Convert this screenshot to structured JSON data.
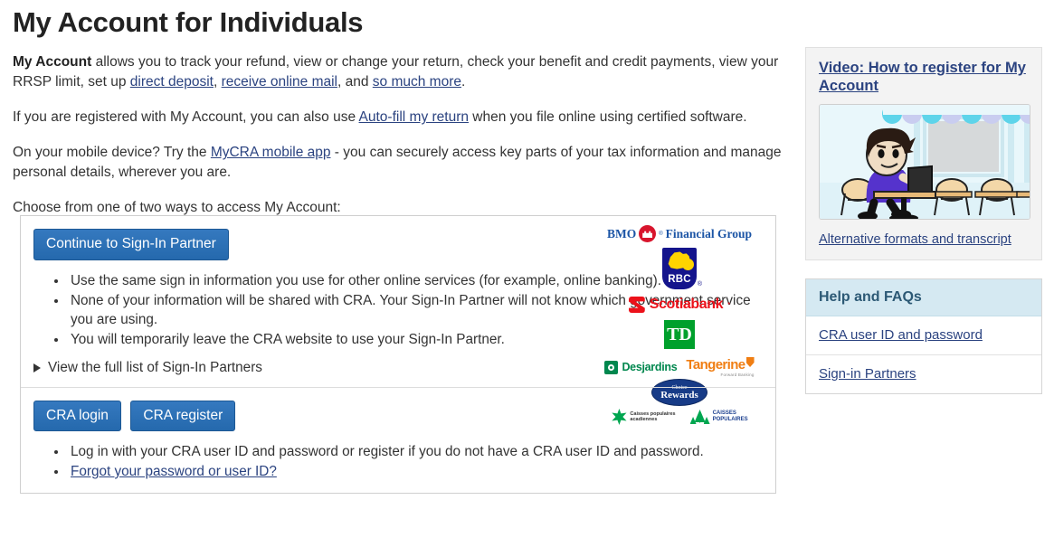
{
  "page": {
    "title": "My Account for Individuals"
  },
  "intro": {
    "p1_lead": "My Account",
    "p1_a": " allows you to track your refund, view or change your return, check your benefit and credit payments, view your RRSP limit, set up ",
    "p1_link1": "direct deposit",
    "p1_b": ", ",
    "p1_link2": "receive online mail",
    "p1_c": ", and ",
    "p1_link3": "so much more",
    "p1_d": ".",
    "p2_a": "If you are registered with My Account, you can also use ",
    "p2_link": "Auto-fill my return",
    "p2_b": " when you file online using certified software.",
    "p3_a": "On your mobile device? Try the ",
    "p3_link": "MyCRA mobile app",
    "p3_b": " - you can securely access key parts of your tax information and manage personal details, wherever you are.",
    "p4": "Choose from one of two ways to access My Account:"
  },
  "signin_partner": {
    "button_label": "Continue to Sign-In Partner",
    "bullets": [
      "Use the same sign in information you use for other online services (for example, online banking).",
      "None of your information will be shared with CRA. Your Sign-In Partner will not know which government service you are using.",
      "You will temporarily leave the CRA website to use your Sign-In Partner."
    ],
    "disclosure_label": "View the full list of Sign-In Partners"
  },
  "partner_logos": {
    "bmo_text_1": "BMO",
    "bmo_text_2": "Financial Group",
    "bmo_registered": "®",
    "rbc_text": "RBC",
    "rbc_registered": "®",
    "scotiabank_text": "Scotiabank",
    "scotiabank_registered": "*",
    "td_text": "TD",
    "desjardins_text": "Desjardins",
    "tangerine_text": "Tangerine",
    "tangerine_tagline": "Forward Banking",
    "choice_rewards_line1": "Choice",
    "choice_rewards_line2": "Rewards",
    "caisses_acadiennes_line1": "Caisses populaires",
    "caisses_acadiennes_line2": "acadiennes",
    "caisses_populaires_line1": "CAISSES",
    "caisses_populaires_line2": "POPULAIRES"
  },
  "cra_login": {
    "login_label": "CRA login",
    "register_label": "CRA register",
    "bullet_1": "Log in with your CRA user ID and password or register if you do not have a CRA user ID and password.",
    "bullet_2_link": "Forgot your password or user ID?"
  },
  "sidebar": {
    "video_link": "Video: How to register for My Account",
    "alt_formats_link": "Alternative formats and transcript",
    "help_title": "Help and FAQs",
    "help_items": [
      {
        "label": "CRA user ID and password"
      },
      {
        "label": "Sign-in Partners"
      }
    ]
  },
  "colors": {
    "button_blue": "#2c70b8",
    "link_blue": "#2b4380",
    "help_header_bg": "#d5e9f2",
    "panel_bg": "#f3f3f3"
  }
}
